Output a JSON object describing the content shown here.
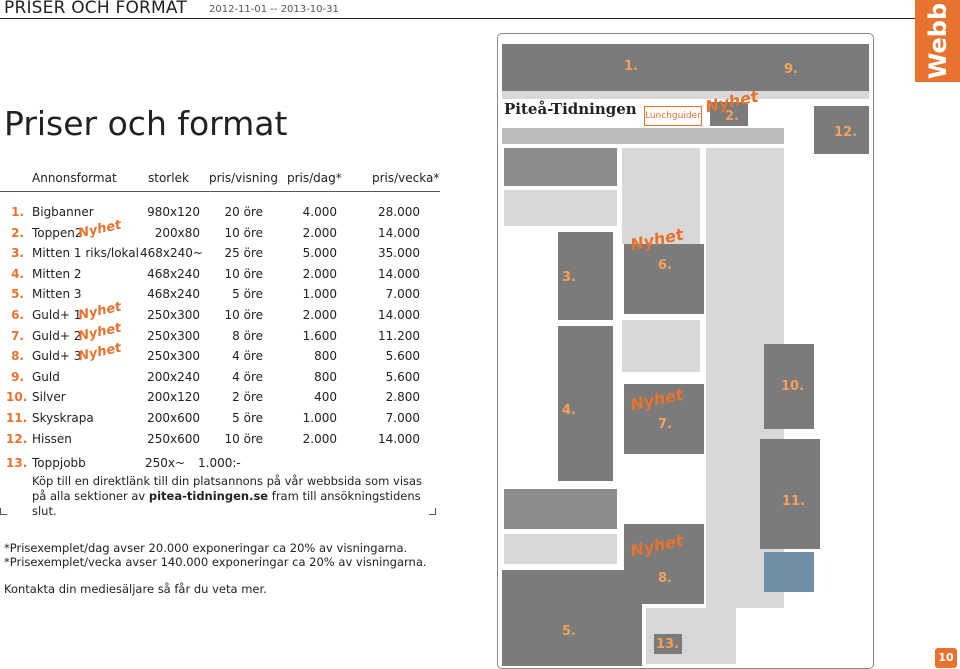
{
  "header": {
    "title": "PRISER OCH FORMAT",
    "period": "2012-11-01 -- 2013-10-31",
    "side_tab": "Webb"
  },
  "main_title": "Priser och format",
  "table": {
    "columns": [
      "Annonsformat",
      "storlek",
      "pris/visning",
      "pris/dag*",
      "pris/vecka*"
    ],
    "badge": "Nyhet",
    "rows": [
      {
        "num": "1.",
        "name": "Bigbanner",
        "size": "980x120",
        "view": "20 öre",
        "day": "4.000",
        "week": "28.000",
        "nyhet": false
      },
      {
        "num": "2.",
        "name": "Toppen2",
        "size": "200x80",
        "view": "10 öre",
        "day": "2.000",
        "week": "14.000",
        "nyhet": true
      },
      {
        "num": "3.",
        "name": "Mitten 1 riks/lokal",
        "size": "468x240~",
        "view": "25 öre",
        "day": "5.000",
        "week": "35.000",
        "nyhet": false
      },
      {
        "num": "4.",
        "name": "Mitten 2",
        "size": "468x240",
        "view": "10 öre",
        "day": "2.000",
        "week": "14.000",
        "nyhet": false
      },
      {
        "num": "5.",
        "name": "Mitten 3",
        "size": "468x240",
        "view": "5 öre",
        "day": "1.000",
        "week": "7.000",
        "nyhet": false
      },
      {
        "num": "6.",
        "name": "Guld+ 1",
        "size": "250x300",
        "view": "10 öre",
        "day": "2.000",
        "week": "14.000",
        "nyhet": true
      },
      {
        "num": "7.",
        "name": "Guld+ 2",
        "size": "250x300",
        "view": "8 öre",
        "day": "1.600",
        "week": "11.200",
        "nyhet": true
      },
      {
        "num": "8.",
        "name": "Guld+ 3",
        "size": "250x300",
        "view": "4 öre",
        "day": "800",
        "week": "5.600",
        "nyhet": true
      },
      {
        "num": "9.",
        "name": "Guld",
        "size": "200x240",
        "view": "4 öre",
        "day": "800",
        "week": "5.600",
        "nyhet": false
      },
      {
        "num": "10.",
        "name": "Silver",
        "size": "200x120",
        "view": "2 öre",
        "day": "400",
        "week": "2.800",
        "nyhet": false
      },
      {
        "num": "11.",
        "name": "Skyskrapa",
        "size": "200x600",
        "view": "5 öre",
        "day": "1.000",
        "week": "7.000",
        "nyhet": false
      },
      {
        "num": "12.",
        "name": "Hissen",
        "size": "250x600",
        "view": "10 öre",
        "day": "2.000",
        "week": "14.000",
        "nyhet": false
      }
    ],
    "row13": {
      "num": "13.",
      "name": "Toppjobb",
      "size": "250x~",
      "price": "1.000:-"
    },
    "row13_note_a": "Köp till en direktlänk till din platsannons på vår webbsida som visas på alla sektioner av ",
    "row13_note_link": "pitea-tidningen.se",
    "row13_note_b": " fram till ansökningstidens slut."
  },
  "footnotes": {
    "line1": "*Prisexemplet/dag avser 20.000 exponeringar ca 20% av visningarna.",
    "line2": "*Prisexemplet/vecka avser 140.000 exponeringar ca 20% av visningarna.",
    "contact": "Kontakta din mediesäljare så får du veta mer."
  },
  "mockup": {
    "site_name": "Piteå-Tidningen",
    "lunchguiden": "Lunchguiden",
    "badge": "Nyhet",
    "slots": [
      "1.",
      "2.",
      "3.",
      "4.",
      "5.",
      "6.",
      "7.",
      "8.",
      "9.",
      "10.",
      "11.",
      "12.",
      "13."
    ]
  },
  "page_number": "10",
  "colors": {
    "accent": "#e8732e",
    "slot": "#7b7b7b",
    "slot_number": "#f5a05a"
  }
}
